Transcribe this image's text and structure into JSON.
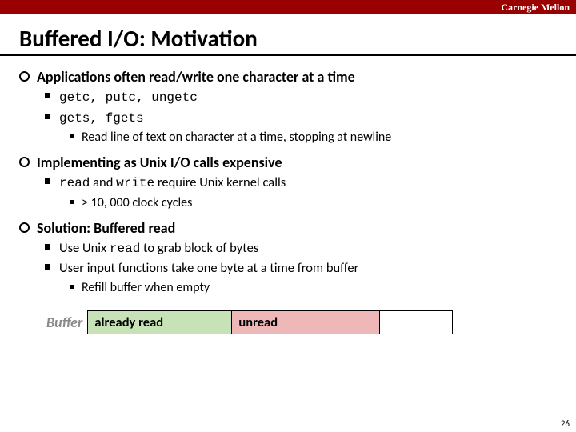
{
  "brand": "Carnegie Mellon",
  "title": "Buffered I/O: Motivation",
  "b1": {
    "head": "Applications often read/write one character at a time",
    "i1": "getc, putc, ungetc",
    "i2": "gets, fgets",
    "i2a": "Read line of text on character at a time, stopping at newline"
  },
  "b2": {
    "head": "Implementing as Unix I/O calls expensive",
    "i1_pre": "read",
    "i1_mid": " and ",
    "i1_code2": "write",
    "i1_post": " require Unix kernel calls",
    "i1a": "> 10, 000 clock cycles"
  },
  "b3": {
    "head": "Solution: Buffered read",
    "i1_pre": "Use Unix ",
    "i1_code": "read",
    "i1_post": " to grab block of bytes",
    "i2": "User input functions take one byte at a time from buffer",
    "i2a": "Refill buffer when empty"
  },
  "buffer": {
    "label": "Buffer",
    "read": "already read",
    "unread": "unread"
  },
  "page": "26"
}
